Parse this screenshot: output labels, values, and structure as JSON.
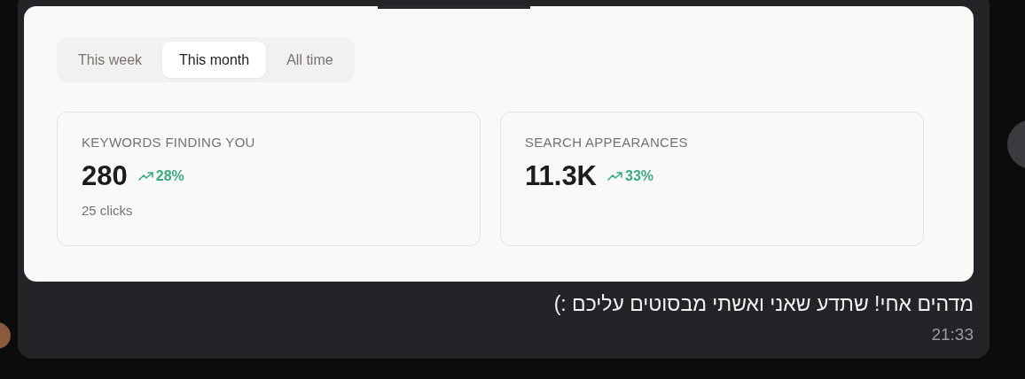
{
  "tabs": [
    {
      "label": "This week",
      "selected": false
    },
    {
      "label": "This month",
      "selected": true
    },
    {
      "label": "All time",
      "selected": false
    }
  ],
  "stats": [
    {
      "label": "KEYWORDS FINDING YOU",
      "value": "280",
      "change": "28%",
      "sub": "25 clicks"
    },
    {
      "label": "SEARCH APPEARANCES",
      "value": "11.3K",
      "change": "33%"
    }
  ],
  "message": {
    "text": "מדהים אחי! שתדע שאני ואשתי מבסוטים עליכם :)",
    "time": "21:33"
  }
}
